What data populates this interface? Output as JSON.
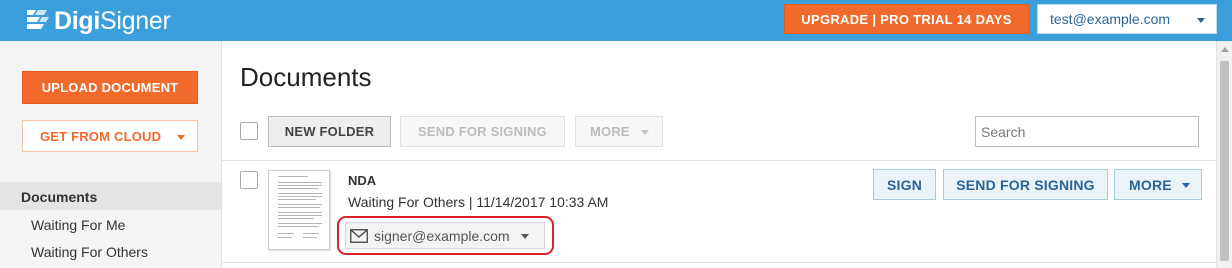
{
  "header": {
    "logo_bold": "Digi",
    "logo_light": "Signer",
    "upgrade_label": "UPGRADE | PRO TRIAL 14 DAYS",
    "user_email": "test@example.com"
  },
  "sidebar": {
    "upload_label": "UPLOAD DOCUMENT",
    "cloud_label": "GET FROM CLOUD",
    "items": [
      {
        "label": "Documents",
        "active": true
      },
      {
        "label": "Waiting For Me"
      },
      {
        "label": "Waiting For Others"
      }
    ]
  },
  "main": {
    "title": "Documents",
    "toolbar": {
      "new_folder_label": "NEW FOLDER",
      "send_label": "SEND FOR SIGNING",
      "more_label": "MORE",
      "search_placeholder": "Search"
    },
    "documents": [
      {
        "name": "NDA",
        "status": "Waiting For Others | 11/14/2017 10:33 AM",
        "signer": "signer@example.com",
        "actions": {
          "sign": "SIGN",
          "send": "SEND FOR SIGNING",
          "more": "MORE"
        }
      }
    ]
  },
  "colors": {
    "header_bg": "#3a9fdb",
    "accent_orange": "#f26a2b",
    "link_blue": "#2a6496",
    "highlight_red": "#d8232a"
  },
  "icons": [
    "logo-icon",
    "chevron-down-icon",
    "envelope-icon",
    "document-thumbnail"
  ]
}
